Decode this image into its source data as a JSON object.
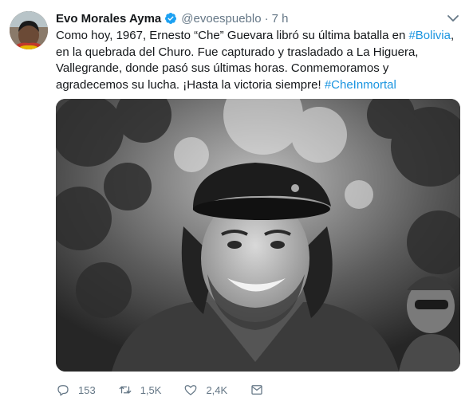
{
  "tweet": {
    "author_name": "Evo Morales Ayma",
    "handle": "@evoespueblo",
    "separator": "·",
    "time": "7 h",
    "text_parts": {
      "p1": "Como hoy, 1967, Ernesto “Che” Guevara libró su última batalla en ",
      "tag1": "#Bolivia",
      "p2": ", en la quebrada del Churo. Fue capturado y trasladado a La Higuera, Vallegrande, donde pasó sus últimas horas. Conmemoramos y agradecemos su lucha. ¡Hasta la victoria siempre! ",
      "tag2": "#CheInmortal"
    },
    "media": {
      "kind": "black-and-white photograph",
      "subject": "smiling man wearing a beret, foliage in background"
    }
  },
  "actions": {
    "reply_count": "153",
    "retweet_count": "1,5K",
    "like_count": "2,4K"
  },
  "icons": {
    "verified": "verified-badge-icon",
    "caret": "chevron-down-icon",
    "reply": "reply-icon",
    "retweet": "retweet-icon",
    "like": "heart-icon",
    "dm": "direct-message-icon"
  },
  "colors": {
    "link": "#1b95e0",
    "verified": "#1da1f2",
    "muted": "#657786",
    "text": "#14171a"
  }
}
